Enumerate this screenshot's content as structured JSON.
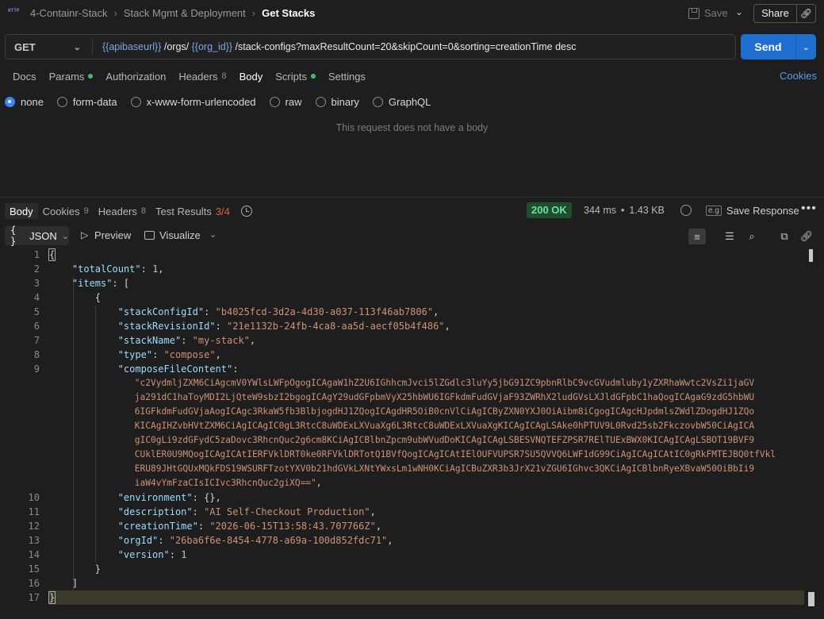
{
  "breadcrumb": {
    "app_icon": "HTTP",
    "items": [
      "4-Containr-Stack",
      "Stack Mgmt & Deployment"
    ],
    "current": "Get Stacks"
  },
  "header": {
    "save_label": "Save",
    "share_label": "Share"
  },
  "request": {
    "method": "GET",
    "url_parts": [
      "{{apibaseurl}}",
      " /orgs/ ",
      "{{org_id}}",
      " /stack-configs?maxResultCount=20&skipCount=0&sorting=creationTime desc"
    ],
    "send_label": "Send"
  },
  "request_tabs": [
    {
      "label": "Docs"
    },
    {
      "label": "Params",
      "dot": true
    },
    {
      "label": "Authorization"
    },
    {
      "label": "Headers",
      "count": "8"
    },
    {
      "label": "Body",
      "active": true
    },
    {
      "label": "Scripts",
      "dot": true
    },
    {
      "label": "Settings"
    }
  ],
  "cookies_link": "Cookies",
  "body_types": [
    {
      "label": "none",
      "selected": true
    },
    {
      "label": "form-data"
    },
    {
      "label": "x-www-form-urlencoded"
    },
    {
      "label": "raw"
    },
    {
      "label": "binary"
    },
    {
      "label": "GraphQL"
    }
  ],
  "no_body_text": "This request does not have a body",
  "response_tabs": [
    {
      "label": "Body",
      "active": true
    },
    {
      "label": "Cookies",
      "count": "9"
    },
    {
      "label": "Headers",
      "count": "8"
    },
    {
      "label": "Test Results",
      "count": "3/4"
    }
  ],
  "response_meta": {
    "status": "200 OK",
    "time": "344 ms",
    "sep": "•",
    "size": "1.43 KB",
    "save_response": "Save Response"
  },
  "response_toolbar": {
    "format": "JSON",
    "preview": "Preview",
    "visualize": "Visualize"
  },
  "code": {
    "line_numbers": [
      "1",
      "2",
      "3",
      "4",
      "5",
      "6",
      "7",
      "8",
      "9",
      "10",
      "11",
      "12",
      "13",
      "14",
      "15",
      "16",
      "17"
    ],
    "stackConfigId": "\"b4025fcd-3d2a-4d30-a037-113f46ab7806\"",
    "stackRevisionId": "\"21e1132b-24fb-4ca8-aa5d-aecf05b4f486\"",
    "stackName": "\"my-stack\"",
    "type": "\"compose\"",
    "composeFileContent_lines": [
      "\"c2VydmljZXM6CiAgcmV0YWlsLWFpOgogICAgaW1hZ2U6IGhhcmJvci5lZGdlc3luYy5jbG91ZC9pbnRlbC9vcGVudmluby1yZXRhaWwtc2VsZi1jaGV",
      "ja291dC1haToyMDI2LjQteW9sbzI2bgogICAgY29udGFpbmVyX25hbWU6IGFkdmFudGVjaF93ZWRhX2ludGVsLXJldGFpbC1haQogICAgaG9zdG5hbWU",
      "6IGFkdmFudGVjaAogICAgc3RkaW5fb3BlbjogdHJ1ZQogICAgdHR5OiB0cnVlCiAgICByZXN0YXJ0OiAibm8iCgogICAgcHJpdmlsZWdlZDogdHJ1ZQo",
      "KICAgIHZvbHVtZXM6CiAgICAgIC0gL3RtcC8uWDExLXVuaXg6L3RtcC8uWDExLXVuaXgKICAgICAgLSAke0hPTUV9L0Rvd25sb2FkczovbW50CiAgICA",
      "gIC0gLi9zdGFydC5zaDovc3RhcnQuc2g6cm8KCiAgICBlbnZpcm9ubWVudDoKICAgICAgLSBESVNQTEFZPSR7RElTUExBWX0KICAgICAgLSBOT19BVF9",
      "CUklER0U9MQogICAgICAtIERFVklDRT0ke0RFVklDRTotQ1BVfQogICAgICAtIElOUFVUPSR7SU5QVVQ6LWF1dG99CiAgICAgICAtIC0gRkFMTEJBQ0tfVkl",
      "ERU89JHtGQUxMQkFDS19WSURFTzotYXV0b21hdGVkLXNtYWxsLm1wNH0KCiAgICBuZXR3b3JrX21vZGU6IGhvc3QKCiAgICBlbnRyeXBvaW50OiBbIi9",
      "iaW4vYmFzaCIsICIvc3RhcnQuc2giXQ==\""
    ],
    "description": "\"AI Self-Checkout Production\"",
    "creationTime": "\"2026-06-15T13:58:43.707766Z\"",
    "orgId": "\"26ba6f6e-8454-4778-a69a-100d852fdc71\"",
    "totalCount": "1",
    "version": "1"
  }
}
